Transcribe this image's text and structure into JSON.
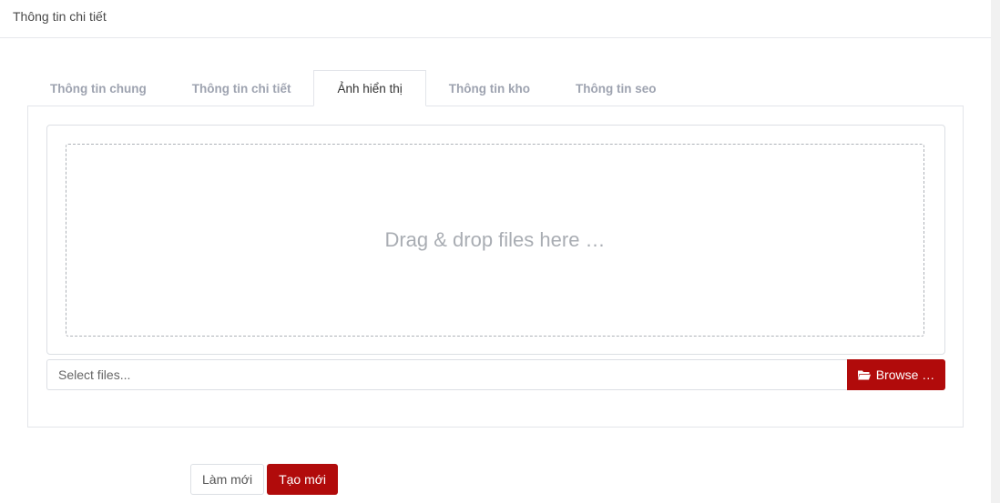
{
  "header": {
    "title": "Thông tin chi tiết"
  },
  "tabs": [
    {
      "label": "Thông tin chung"
    },
    {
      "label": "Thông tin chi tiết"
    },
    {
      "label": "Ảnh hiển thị",
      "active": true
    },
    {
      "label": "Thông tin kho"
    },
    {
      "label": "Thông tin seo"
    }
  ],
  "upload": {
    "drop_text": "Drag & drop files here …",
    "placeholder": "Select files...",
    "browse_label": "Browse …",
    "browse_icon": "folder-open-icon"
  },
  "actions": {
    "reset_label": "Làm mới",
    "create_label": "Tạo mới"
  },
  "colors": {
    "accent": "#b10b0b",
    "inactive_tab": "#9ea3b0"
  }
}
